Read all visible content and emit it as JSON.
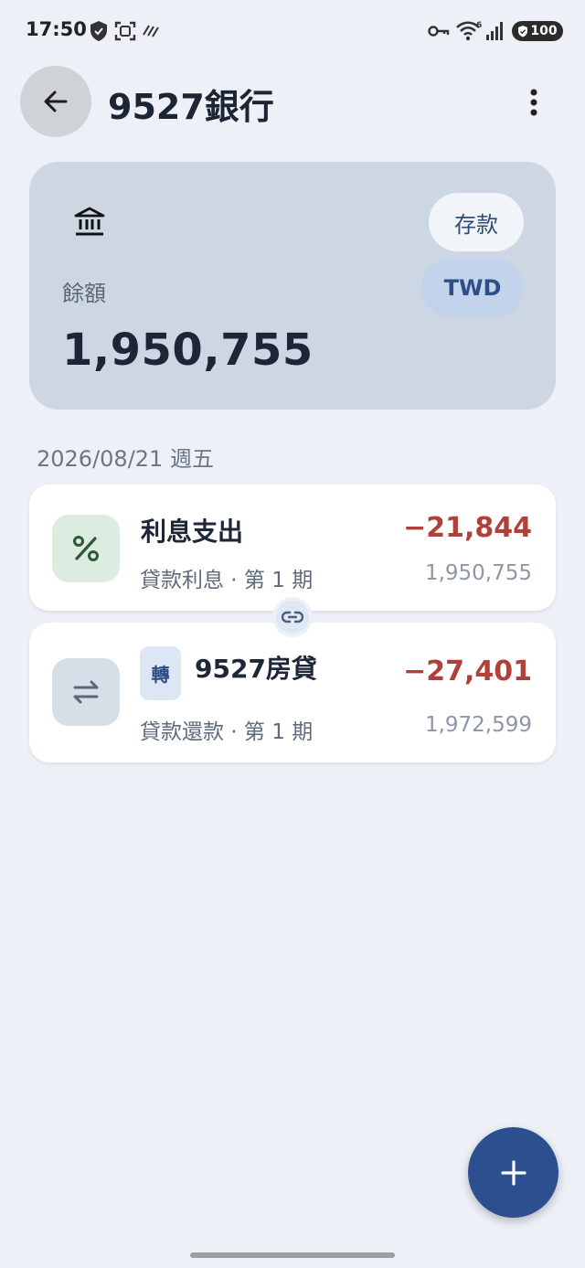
{
  "status_bar": {
    "time": "17:50",
    "battery": "100",
    "icons": [
      "shield-icon",
      "face-scan-icon",
      "signal-lines-icon",
      "key-icon",
      "wifi-icon",
      "cell-signal-icon"
    ],
    "wifi_badge": "6"
  },
  "header": {
    "title": "9527銀行",
    "back_icon": "arrow-left-icon",
    "menu_icon": "more-vert-icon"
  },
  "account": {
    "icon": "bank-icon",
    "type_chip": "存款",
    "currency_chip": "TWD",
    "balance_label": "餘額",
    "balance_value": "1,950,755"
  },
  "date_header": "2026/08/21 週五",
  "transactions": [
    {
      "icon": "percent-icon",
      "title": "利息支出",
      "subtitle": "貸款利息 · 第 1 期",
      "amount": "−21,844",
      "running_balance": "1,950,755"
    },
    {
      "icon": "swap-arrows-icon",
      "badge": "轉",
      "title": "9527房貸",
      "subtitle": "貸款還款 · 第 1 期",
      "amount": "−27,401",
      "running_balance": "1,972,599"
    }
  ],
  "link_icon": "link-icon",
  "fab_icon": "plus-icon",
  "colors": {
    "background": "#edf1f7",
    "card": "#cdd7e3",
    "negative_amount": "#b0413a",
    "fab": "#2c4f8f"
  }
}
